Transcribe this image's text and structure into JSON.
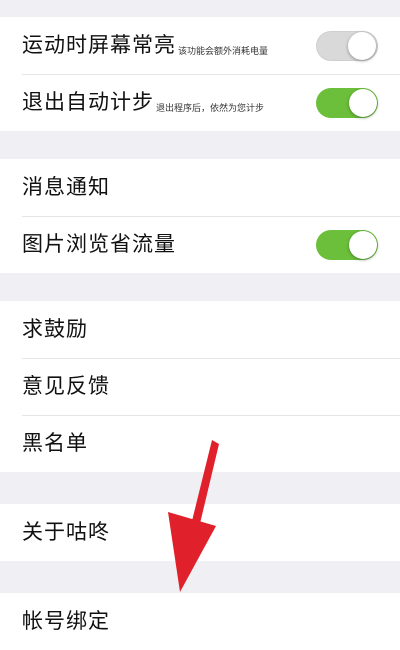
{
  "settings": {
    "group1": [
      {
        "label": "运动时屏幕常亮",
        "hint": "该功能会额外消耗电量",
        "toggle": "off"
      },
      {
        "label": "退出自动计步",
        "hint": "退出程序后，依然为您计步",
        "toggle": "on"
      }
    ],
    "group2": [
      {
        "label": "消息通知"
      },
      {
        "label": "图片浏览省流量",
        "toggle": "on"
      }
    ],
    "group3": [
      {
        "label": "求鼓励"
      },
      {
        "label": "意见反馈"
      },
      {
        "label": "黑名单"
      }
    ],
    "group4": [
      {
        "label": "关于咕咚"
      }
    ],
    "group5": [
      {
        "label": "帐号绑定"
      }
    ]
  },
  "colors": {
    "toggle_on": "#6bbf3a",
    "toggle_off": "#d9d9d9",
    "background": "#efeff4",
    "annotation_arrow": "#e0202a"
  }
}
